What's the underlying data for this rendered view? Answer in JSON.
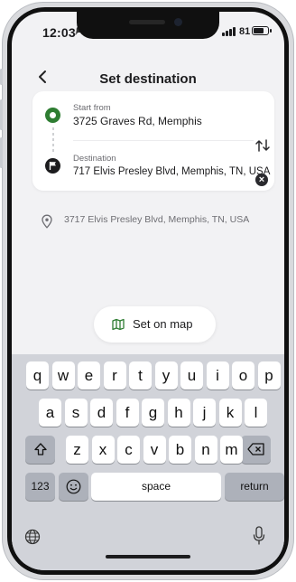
{
  "status_bar": {
    "time": "12:03",
    "battery": "81",
    "battery_level": 0.81
  },
  "header": {
    "title": "Set destination"
  },
  "route": {
    "start_label": "Start from",
    "start_value": "3725 Graves Rd, Memphis",
    "destination_label": "Destination",
    "destination_value": "717 Elvis Presley Blvd, Memphis, TN, USA"
  },
  "suggestions": [
    {
      "text": "3717 Elvis Presley Blvd, Memphis, TN, USA",
      "icon": "location-pin-icon"
    }
  ],
  "set_on_map": {
    "label": "Set on map",
    "icon": "map-icon"
  },
  "keyboard": {
    "row1": [
      "q",
      "w",
      "e",
      "r",
      "t",
      "y",
      "u",
      "i",
      "o",
      "p"
    ],
    "row2": [
      "a",
      "s",
      "d",
      "f",
      "g",
      "h",
      "j",
      "k",
      "l"
    ],
    "row3": [
      "z",
      "x",
      "c",
      "v",
      "b",
      "n",
      "m"
    ],
    "shift_icon": "shift-icon",
    "delete_icon": "delete-icon",
    "numbers_label": "123",
    "emoji_icon": "emoji-icon",
    "space_label": "space",
    "return_label": "return",
    "globe_icon": "globe-icon",
    "mic_icon": "microphone-icon"
  },
  "colors": {
    "start_marker": "#2e7d32",
    "accent_dark": "#1c1c1e",
    "keyboard_bg": "#d1d3d9"
  }
}
